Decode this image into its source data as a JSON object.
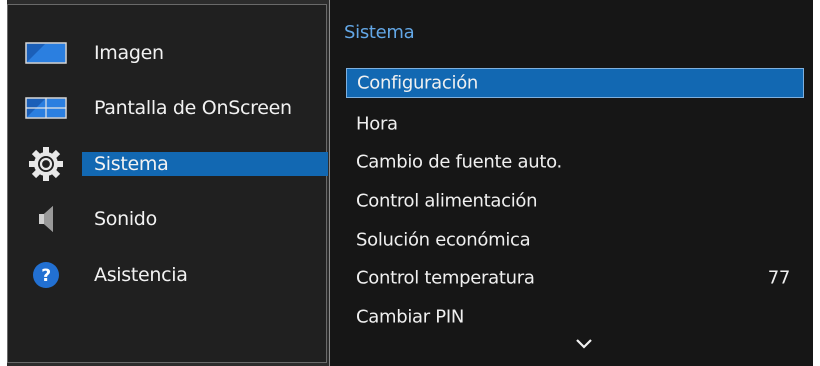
{
  "sidebar": {
    "items": [
      {
        "label": "Imagen",
        "icon": "picture-icon"
      },
      {
        "label": "Pantalla de OnScreen",
        "icon": "onscreen-display-icon"
      },
      {
        "label": "Sistema",
        "icon": "gear-icon",
        "selected": true
      },
      {
        "label": "Sonido",
        "icon": "speaker-icon"
      },
      {
        "label": "Asistencia",
        "icon": "help-icon"
      }
    ]
  },
  "submenu": {
    "title": "Sistema",
    "items": [
      {
        "label": "Configuración",
        "selected": true
      },
      {
        "label": "Hora"
      },
      {
        "label": "Cambio de fuente auto."
      },
      {
        "label": "Control alimentación"
      },
      {
        "label": "Solución económica"
      },
      {
        "label": "Control temperatura",
        "value": "77"
      },
      {
        "label": "Cambiar PIN"
      }
    ],
    "scroll_icon": "chevron-down-icon"
  },
  "colors": {
    "accent": "#1268b2",
    "title": "#63a7e6"
  }
}
